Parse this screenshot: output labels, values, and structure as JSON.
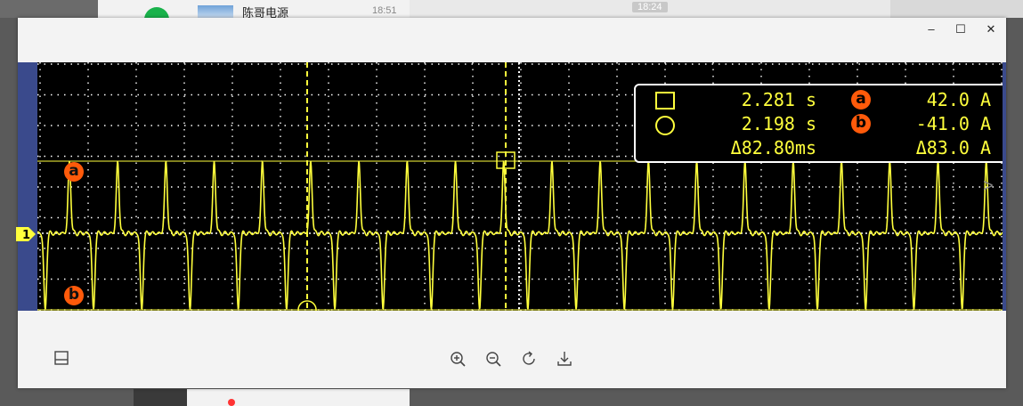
{
  "background": {
    "chat_name": "陈哥电源",
    "chat_time": "18:51",
    "center_time": "18:24"
  },
  "window": {
    "minimize_glyph": "–",
    "maximize_glyph": "☐",
    "close_glyph": "✕"
  },
  "scope": {
    "channel_label": "1",
    "marker_a": "a",
    "marker_b": "b",
    "trace_color": "#ffff3c",
    "grid_color": "#ffffff"
  },
  "readout": {
    "cursor1_time": "2.281 s",
    "cursor2_time": "2.198 s",
    "delta_time": "Δ82.80ms",
    "a_label": "a",
    "b_label": "b",
    "a_value": "42.0 A",
    "b_value": "-41.0 A",
    "delta_value": "Δ83.0 A"
  },
  "toolbar": {
    "icons": [
      "thumbnail-icon",
      "zoom-in-icon",
      "zoom-out-icon",
      "rotate-icon",
      "download-icon"
    ]
  }
}
